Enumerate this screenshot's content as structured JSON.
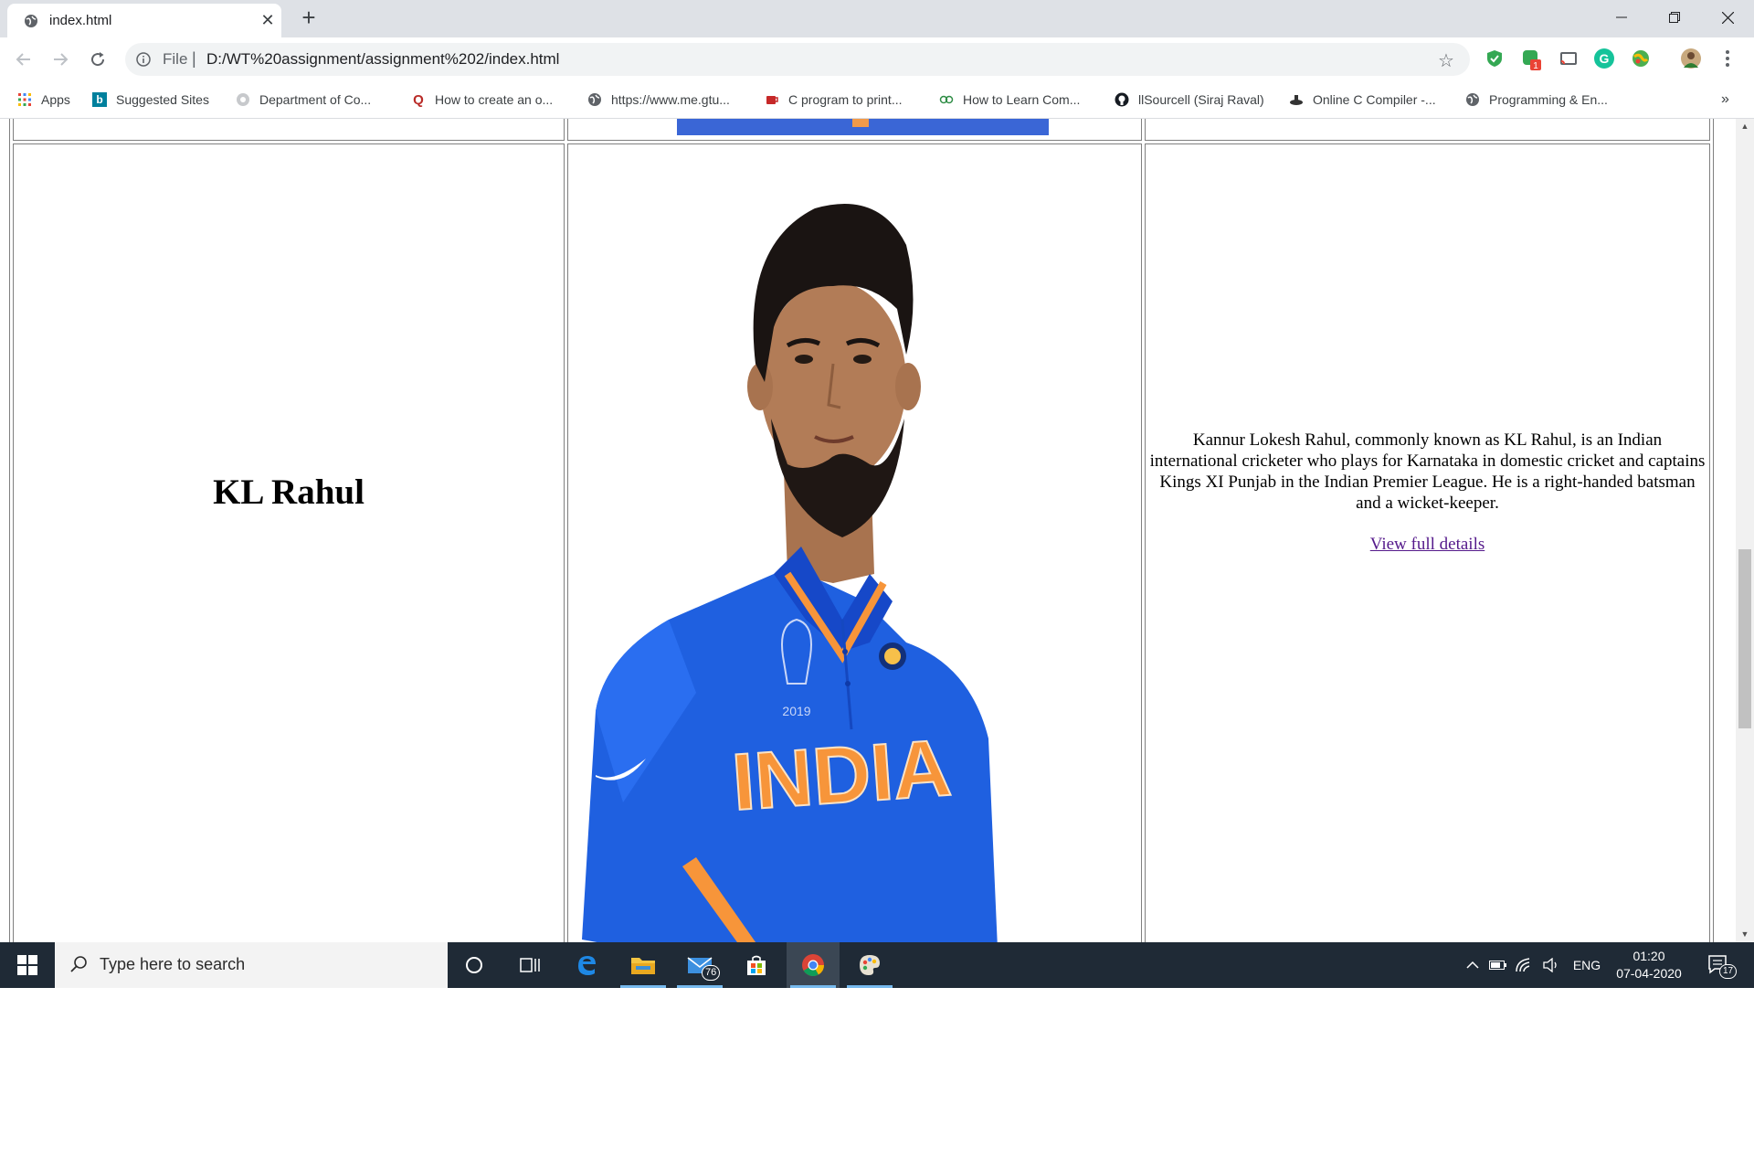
{
  "browser": {
    "tab_title": "index.html",
    "omnibox": {
      "scheme_label": "File",
      "url": "D:/WT%20assignment/assignment%202/index.html"
    },
    "extensions": [
      {
        "name": "shield-extension",
        "color": "#34a853"
      },
      {
        "name": "counter-extension",
        "color": "#34a853",
        "badge": "1"
      },
      {
        "name": "cast-extension",
        "color": "#5f6368"
      },
      {
        "name": "grammarly-extension",
        "color": "#15c39a"
      },
      {
        "name": "globe-extension",
        "color": "#4caf50"
      }
    ],
    "bookmarks": [
      {
        "label": "Apps",
        "icon": "apps-grid-icon"
      },
      {
        "label": "Suggested Sites",
        "icon": "bing-icon"
      },
      {
        "label": "Department of Co...",
        "icon": "gear-badge-icon"
      },
      {
        "label": "How to create an o...",
        "icon": "quora-icon"
      },
      {
        "label": "https://www.me.gtu...",
        "icon": "globe-icon"
      },
      {
        "label": "C program to print...",
        "icon": "cup-icon"
      },
      {
        "label": "How to Learn Com...",
        "icon": "geeks-icon"
      },
      {
        "label": "llSourcell (Siraj Raval)",
        "icon": "github-icon"
      },
      {
        "label": "Online C Compiler -...",
        "icon": "compiler-icon"
      },
      {
        "label": "Programming & En...",
        "icon": "globe-icon"
      }
    ],
    "bookmarks_overflow": "»"
  },
  "page": {
    "player_name": "KL Rahul",
    "description": "Kannur Lokesh Rahul, commonly known as KL Rahul, is an Indian international cricketer who plays for Karnataka in domestic cricket and captains Kings XI Punjab in the Indian Premier League. He is a right-handed batsman and a wicket-keeper.",
    "link_text": "View full details",
    "jersey_text": "INDIA",
    "jersey_year": "2019"
  },
  "taskbar": {
    "search_placeholder": "Type here to search",
    "mail_badge": "76",
    "language": "ENG",
    "time": "01:20",
    "date": "07-04-2020",
    "notification_count": "17"
  }
}
